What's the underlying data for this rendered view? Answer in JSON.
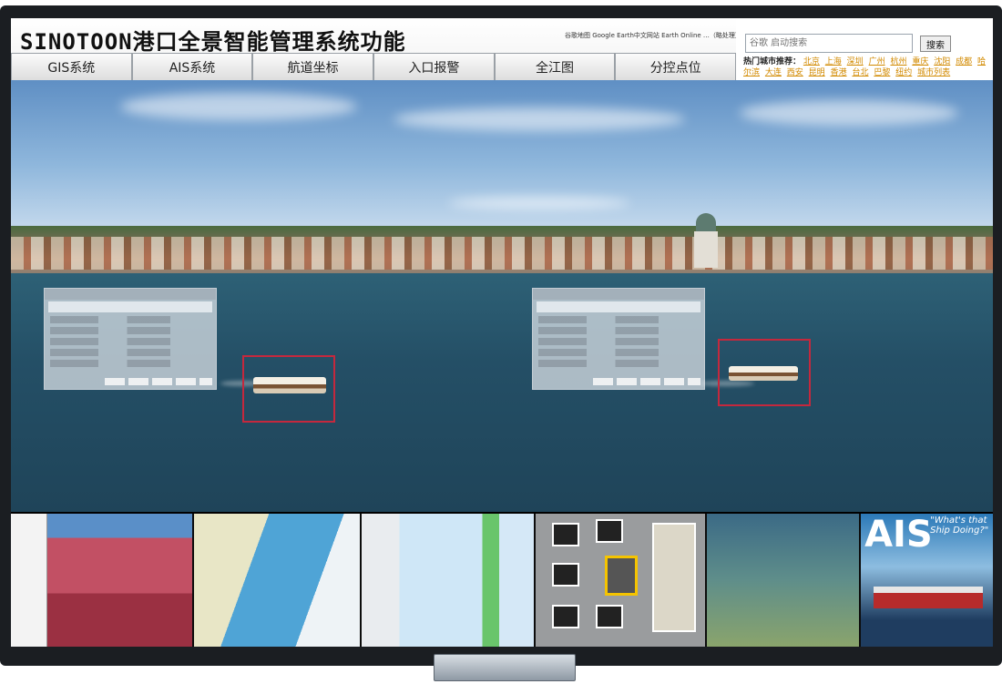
{
  "header": {
    "title": "SINOTOON港口全景智能管理系统功能",
    "top_links": "谷歌地图 Google Earth中文网站 Earth Online …（略处理）",
    "search_placeholder": "谷歌 启动搜索",
    "search_button": "搜索",
    "hot_cities_label": "热门城市推荐：",
    "hot_cities": [
      "北京",
      "上海",
      "深圳",
      "广州",
      "杭州",
      "重庆",
      "沈阳",
      "成都",
      "哈尔滨",
      "大连",
      "西安",
      "昆明",
      "香港",
      "台北",
      "巴黎",
      "纽约",
      "城市列表"
    ]
  },
  "nav": {
    "items": [
      {
        "label": "GIS系统"
      },
      {
        "label": "AIS系统"
      },
      {
        "label": "航道坐标"
      },
      {
        "label": "入口报警"
      },
      {
        "label": "全江图"
      },
      {
        "label": "分控点位"
      }
    ]
  },
  "thumbnails": {
    "ais_title": "AIS",
    "ais_caption": "\"What's that Ship Doing?\""
  },
  "colors": {
    "frame": "#1b1e22",
    "highlight_box": "#c5283d",
    "city_link": "#d28a00"
  }
}
